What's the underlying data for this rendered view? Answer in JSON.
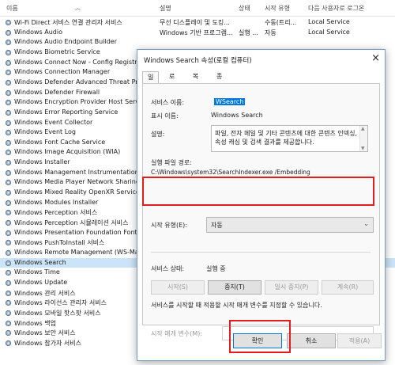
{
  "header": {
    "name": "이름",
    "desc": "설명",
    "status": "상태",
    "type": "시작 유형",
    "logon": "다음 사용자로 로그온"
  },
  "services": [
    {
      "name": "Wi-Fi Direct 서비스 연결 관리자 서비스",
      "desc": "무선 디스플레이 및 도킹...",
      "status": "",
      "type": "수동(트리...",
      "logon": "Local Service"
    },
    {
      "name": "Windows Audio",
      "desc": "Windows 기반 프로그램...",
      "status": "실행 ...",
      "type": "자동",
      "logon": "Local Service"
    },
    {
      "name": "Windows Audio Endpoint Builder",
      "desc": "",
      "status": "",
      "type": "",
      "logon": ""
    },
    {
      "name": "Windows Biometric Service",
      "desc": "",
      "status": "",
      "type": "",
      "logon": ""
    },
    {
      "name": "Windows Connect Now - Config Registrar",
      "desc": "",
      "status": "",
      "type": "",
      "logon": ""
    },
    {
      "name": "Windows Connection Manager",
      "desc": "",
      "status": "",
      "type": "",
      "logon": ""
    },
    {
      "name": "Windows Defender Advanced Threat Protect",
      "desc": "",
      "status": "",
      "type": "",
      "logon": ""
    },
    {
      "name": "Windows Defender Firewall",
      "desc": "",
      "status": "",
      "type": "",
      "logon": ""
    },
    {
      "name": "Windows Encryption Provider Host Service",
      "desc": "",
      "status": "",
      "type": "",
      "logon": ""
    },
    {
      "name": "Windows Error Reporting Service",
      "desc": "",
      "status": "",
      "type": "",
      "logon": ""
    },
    {
      "name": "Windows Event Collector",
      "desc": "",
      "status": "",
      "type": "",
      "logon": ""
    },
    {
      "name": "Windows Event Log",
      "desc": "",
      "status": "",
      "type": "",
      "logon": ""
    },
    {
      "name": "Windows Font Cache Service",
      "desc": "",
      "status": "",
      "type": "",
      "logon": ""
    },
    {
      "name": "Windows Image Acquisition (WIA)",
      "desc": "",
      "status": "",
      "type": "",
      "logon": ""
    },
    {
      "name": "Windows Installer",
      "desc": "",
      "status": "",
      "type": "",
      "logon": ""
    },
    {
      "name": "Windows Management Instrumentation",
      "desc": "",
      "status": "",
      "type": "",
      "logon": ""
    },
    {
      "name": "Windows Media Player Network Sharing Se",
      "desc": "",
      "status": "",
      "type": "",
      "logon": ""
    },
    {
      "name": "Windows Mixed Reality OpenXR Service",
      "desc": "",
      "status": "",
      "type": "",
      "logon": ""
    },
    {
      "name": "Windows Modules Installer",
      "desc": "",
      "status": "",
      "type": "",
      "logon": ""
    },
    {
      "name": "Windows Perception 서비스",
      "desc": "",
      "status": "",
      "type": "",
      "logon": ""
    },
    {
      "name": "Windows Perception 시뮬레이션 서비스",
      "desc": "",
      "status": "",
      "type": "",
      "logon": ""
    },
    {
      "name": "Windows Presentation Foundation Font Ca",
      "desc": "",
      "status": "",
      "type": "",
      "logon": ""
    },
    {
      "name": "Windows PushToInstall 서비스",
      "desc": "",
      "status": "",
      "type": "",
      "logon": ""
    },
    {
      "name": "Windows Remote Management (WS-Manag",
      "desc": "",
      "status": "",
      "type": "",
      "logon": ""
    },
    {
      "name": "Windows Search",
      "desc": "",
      "status": "",
      "type": "",
      "logon": ""
    },
    {
      "name": "Windows Time",
      "desc": "",
      "status": "",
      "type": "",
      "logon": ""
    },
    {
      "name": "Windows Update",
      "desc": "",
      "status": "",
      "type": "",
      "logon": ""
    },
    {
      "name": "Windows 관리 서비스",
      "desc": "",
      "status": "",
      "type": "",
      "logon": ""
    },
    {
      "name": "Windows 라이선스 관리자 서비스",
      "desc": "",
      "status": "",
      "type": "",
      "logon": ""
    },
    {
      "name": "Windows 모바일 핫스팟 서비스",
      "desc": "",
      "status": "",
      "type": "",
      "logon": ""
    },
    {
      "name": "Windows 백업",
      "desc": "",
      "status": "",
      "type": "",
      "logon": ""
    },
    {
      "name": "Windows 보안 서비스",
      "desc": "",
      "status": "",
      "type": "",
      "logon": ""
    },
    {
      "name": "Windows 참가자 서비스",
      "desc": "Windows 참가자 프로그...",
      "status": "",
      "type": "수동 (트리...",
      "logon": "Local System"
    }
  ],
  "dialog": {
    "title": "Windows Search 속성(로컬 컴퓨터)",
    "close": "×",
    "tabs": [
      "일반",
      "로그온",
      "복구",
      "종속성"
    ],
    "service_name_label": "서비스 이름:",
    "service_name": "WSearch",
    "display_name_label": "표시 이름:",
    "display_name": "Windows Search",
    "description_label": "설명:",
    "description": "파일, 전자 메일 및 기타 콘텐츠에 대한 콘텐츠 인덱싱, 속성 캐싱 및 검색 결과를 제공합니다.",
    "exe_path_label": "실행 파일 경로:",
    "exe_path": "C:\\Windows\\system32\\SearchIndexer.exe /Embedding",
    "startup_type_label": "시작 유형(E):",
    "startup_type": "자동",
    "service_status_label": "서비스 상태:",
    "service_status": "실행 중",
    "btn_start": "시작(S)",
    "btn_stop": "중지(T)",
    "btn_pause": "일시 중지(P)",
    "btn_resume": "계속(R)",
    "hint": "서비스를 시작할 때 적용할 시작 매개 변수를 지정할 수 있습니다.",
    "start_params_label": "시작 매개 변수(M):",
    "btn_ok": "확인",
    "btn_cancel": "취소",
    "btn_apply": "적용(A)"
  },
  "colors": {
    "highlight": "#e01e1e",
    "selection": "#0078d7"
  }
}
